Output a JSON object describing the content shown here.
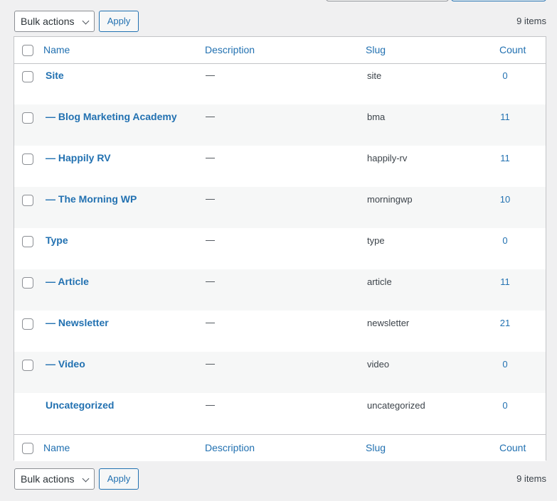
{
  "bulk_actions_label": "Bulk actions",
  "apply_label": "Apply",
  "items_count": "9 items",
  "columns": {
    "name": "Name",
    "description": "Description",
    "slug": "Slug",
    "count": "Count"
  },
  "rows": [
    {
      "name": "Site",
      "description": "—",
      "slug": "site",
      "count": "0",
      "checkbox": true
    },
    {
      "name": "— Blog Marketing Academy",
      "description": "—",
      "slug": "bma",
      "count": "11",
      "checkbox": true
    },
    {
      "name": "— Happily RV",
      "description": "—",
      "slug": "happily-rv",
      "count": "11",
      "checkbox": true
    },
    {
      "name": "— The Morning WP",
      "description": "—",
      "slug": "morningwp",
      "count": "10",
      "checkbox": true
    },
    {
      "name": "Type",
      "description": "—",
      "slug": "type",
      "count": "0",
      "checkbox": true
    },
    {
      "name": "— Article",
      "description": "—",
      "slug": "article",
      "count": "11",
      "checkbox": true
    },
    {
      "name": "— Newsletter",
      "description": "—",
      "slug": "newsletter",
      "count": "21",
      "checkbox": true
    },
    {
      "name": "— Video",
      "description": "—",
      "slug": "video",
      "count": "0",
      "checkbox": true
    },
    {
      "name": "Uncategorized",
      "description": "—",
      "slug": "uncategorized",
      "count": "0",
      "checkbox": false
    }
  ],
  "colors": {
    "link": "#2271b1",
    "text": "#3c434a",
    "page_bg": "#f0f0f1",
    "alt_row": "#f6f7f7",
    "border": "#c3c4c7"
  }
}
